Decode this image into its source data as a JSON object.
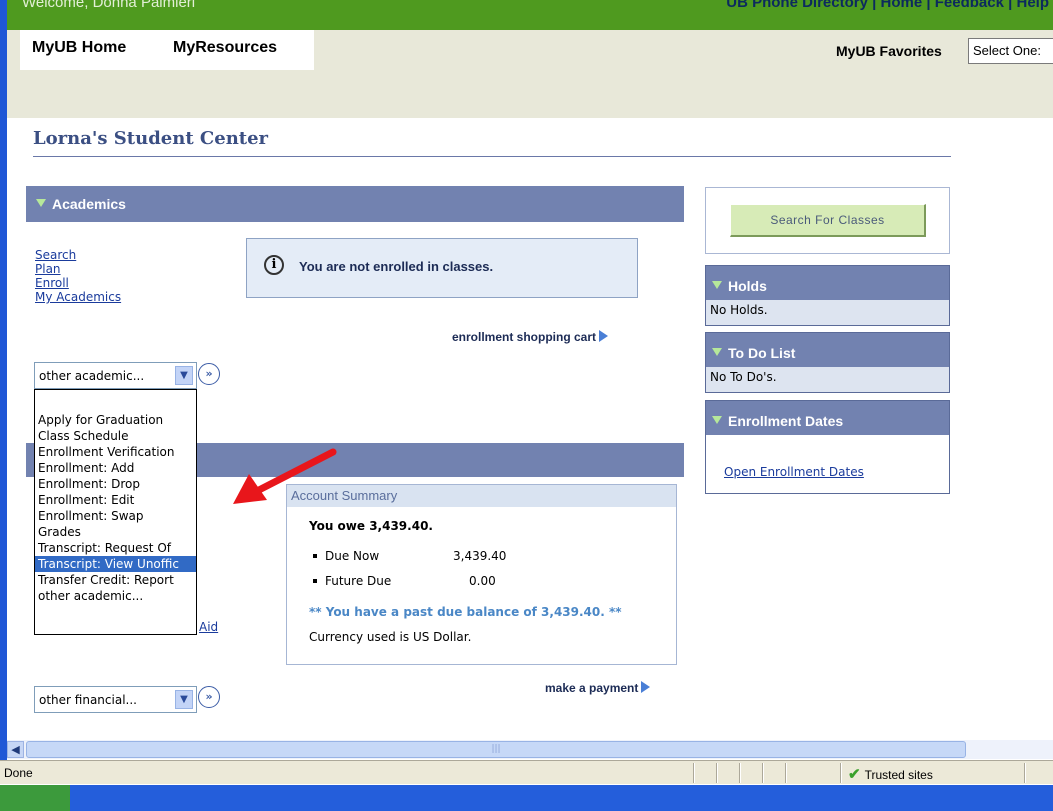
{
  "header": {
    "welcome": "Welcome,  Donna Palmieri",
    "links": [
      "UB Phone Directory",
      "Home",
      "Feedback",
      "Help"
    ]
  },
  "nav": {
    "tabs": [
      "MyUB Home",
      "MyResources"
    ],
    "favorites_label": "MyUB Favorites",
    "favorites_select": "Select One:"
  },
  "page": {
    "title": "Lorna's Student Center"
  },
  "academics": {
    "title": "Academics",
    "links": [
      "Search",
      "Plan",
      "Enroll",
      "My Academics"
    ],
    "notice": "You are not enrolled in classes.",
    "cart_link": "enrollment shopping cart",
    "select_value": "other academic...",
    "options": [
      "Apply for Graduation",
      "Class Schedule",
      "Enrollment Verification",
      "Enrollment: Add",
      "Enrollment: Drop",
      "Enrollment: Edit",
      "Enrollment: Swap",
      "Grades",
      "Transcript: Request Of",
      "Transcript: View Unoffic",
      "Transfer Credit: Report",
      "other academic..."
    ],
    "selected_option": "Transcript: View Unoffic"
  },
  "finances": {
    "aid_link_fragment": "Aid",
    "account_summary": {
      "title": "Account Summary",
      "owe": "You owe 3,439.40.",
      "due_now_label": "Due Now",
      "due_now_value": "3,439.40",
      "future_due_label": "Future Due",
      "future_due_value": "0.00",
      "past_due_msg": "** You have a past due balance of 3,439.40. **",
      "currency": "Currency used is US Dollar."
    },
    "pay_link": "make a payment",
    "select_value": "other financial..."
  },
  "sidebar": {
    "search_button": "Search For Classes",
    "holds": {
      "title": "Holds",
      "body": "No Holds."
    },
    "todo": {
      "title": "To Do List",
      "body": "No To Do's."
    },
    "enrollment_dates": {
      "title": "Enrollment Dates",
      "link": "Open Enrollment Dates"
    }
  },
  "statusbar": {
    "text": "Done",
    "zone": "Trusted sites"
  },
  "colors": {
    "accent_bar": "#7282b0",
    "top_green": "#4f9a1f",
    "annotation_arrow": "#e8161b"
  }
}
